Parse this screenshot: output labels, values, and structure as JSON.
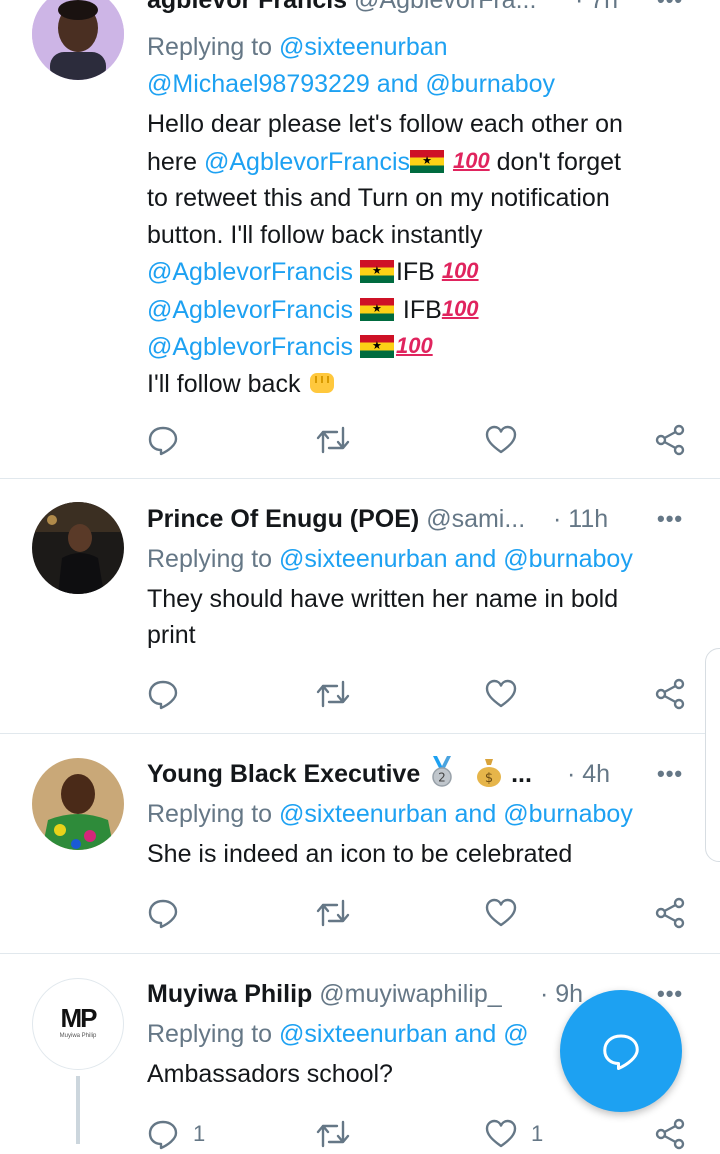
{
  "tweets": [
    {
      "name": "agblevor Francis",
      "handle": "@AgblevorFra...",
      "time": "· 7h",
      "more": "•••",
      "reply_prefix": "Replying to",
      "reply_line1": "@sixteenurban",
      "reply_line2a": "@Michael98793229",
      "reply_and": "and",
      "reply_line2b": "@burnaboy",
      "text_l1": "Hello dear please let's follow each other on",
      "text_l2_pre": "here",
      "text_l2_mention": "@AgblevorFrancis",
      "text_l2_post": "don't forget",
      "text_l3": "to retweet this and  Turn on my notification",
      "text_l4": "button. I'll follow back instantly",
      "mention": "@AgblevorFrancis",
      "ifb1": "IFB",
      "ifb2": "IFB",
      "hundred": "100",
      "text_last": "I'll follow back"
    },
    {
      "name": "Prince Of Enugu (POE)",
      "handle": "@sami...",
      "time": "· 11h",
      "more": "•••",
      "reply_prefix": "Replying to",
      "reply_a": "@sixteenurban",
      "reply_and": "and",
      "reply_b": "@burnaboy",
      "text_l1": "They should have written her name in bold",
      "text_l2": "print"
    },
    {
      "name": "Young Black Executive",
      "name_suffix": "...",
      "time": "· 4h",
      "more": "•••",
      "reply_prefix": "Replying to",
      "reply_a": "@sixteenurban",
      "reply_and": "and",
      "reply_b": "@burnaboy",
      "text_l1": "She is indeed an icon to be celebrated"
    },
    {
      "name": "Muyiwa Philip",
      "handle": "@muyiwaphilip_",
      "time": "· 9h",
      "more": "•••",
      "avatar_text": "MP",
      "avatar_sub": "Muyiwa Philip",
      "reply_prefix": "Replying to",
      "reply_a": "@sixteenurban",
      "reply_and": "and",
      "reply_b": "@",
      "text_l1": "Ambassadors school?",
      "reply_count": "1",
      "like_count": "1"
    }
  ],
  "icons": {
    "reply": "reply-icon",
    "retweet": "retweet-icon",
    "like": "like-icon",
    "share": "share-icon",
    "compose": "compose-reply-icon"
  },
  "colors": {
    "accent": "#1da1f2",
    "muted": "#657786",
    "text": "#14171a"
  }
}
